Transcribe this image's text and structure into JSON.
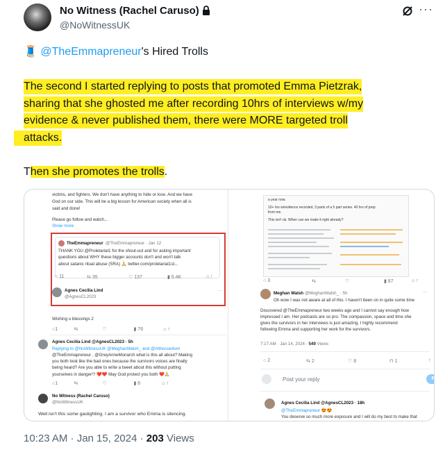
{
  "author": {
    "name": "No Witness (Rachel Caruso)",
    "handle": "@NoWitnessUK"
  },
  "icons": {
    "lock": "lock-icon",
    "grok": "grok-icon",
    "more": "more-icon",
    "spool": "spool-of-thread-emoji"
  },
  "body": {
    "line1_emoji": "🧵",
    "line1_mention": "@TheEmmapreneur",
    "line1_rest": "'s Hired Trolls",
    "p1": [
      "The second I started replying to posts that promoted Emma Pietzrak,",
      "sharing that she ghosted me after recording 10hrs of interviews w/my",
      "evidence & never published them, there were MORE targeted troll",
      "attacks."
    ],
    "p2_plain": "T",
    "p2_hl": "hen she promotes the trolls",
    "p2_end": "."
  },
  "media_left": {
    "top_text": [
      "victims, and fighters. We don't have anything to hide or lose. And we have",
      "God on our side. This will be a big lesson for American society when all is",
      "said and done!"
    ],
    "follow": "Please go follow and watch...",
    "show_more": "Show more",
    "quote_name": "TheEmmapreneur",
    "quote_handle": "@TheEmmapreneur · Jan 12",
    "quote_text": [
      "THANK YOU @Proletariat1 for the shout-out and for asking important",
      "questions about WHY these bigger accounts don't and won't talk",
      "about satanic ritual abuse (SRA) 🙏 twitter.com/proletariat1st..."
    ],
    "quote_actions": [
      "11",
      "35",
      "137",
      "5.4K"
    ],
    "reply1_name": "Agnes Cecilia Lind",
    "reply1_handle": "@AgnesCL2023",
    "wishing": "Wishing u blessings 2",
    "reply2_header": "Agnes Cecilia Lind @AgnesCL2023 · 5h",
    "reply2_text": [
      "Replying to @NoWitnessUK @MeghanWalsh_ and @Althouse4om",
      "@TheEmmapreneur , @GreyAnneMonarch what is this all about? Making",
      "you both look like the bad ones because the survivors voices are finally",
      "being heard? Are you able to write a tweet about this without putting",
      "yourselves in danger!? ❤️❤️ May God protect you both ❤️🙏"
    ],
    "reply3_name": "No Witness (Rachel Caruso)",
    "reply3_handle": "@NoWitnessUK",
    "reply3_text": "Well isn't this some gaslighting. I am a survivor who Emma is silencing."
  },
  "media_right": {
    "embed_lines": [
      "a year now.",
      "10+ hrs w/evidence recorded, 3 parts of a 5 part series. 40 hrs of prep",
      "from me.",
      "This isn't ok. When can we make it right already?"
    ],
    "embed_actions": [
      "3",
      "87"
    ],
    "meghan_name": "Meghan Walsh",
    "meghan_handle": "@MeghanWalsh_ · 5h",
    "meghan_line": "Oh wow I was not aware at all of this. I haven't been on in quite some time",
    "meghan_text": [
      "Discovered @TheEmmapreneur two weeks ago and I cannot say enough how",
      "impressed I am. Her podcasts are so pro. The compassion, space and time she",
      "gives the survivors in her interviews is just amazing. I highly recommend",
      "following Emma and supporting her work for the survivors."
    ],
    "meghan_time": "7:17 AM · Jan 14, 2024 · ",
    "meghan_views_num": "549",
    "meghan_views_label": " Views",
    "meghan_actions": [
      "2",
      "2",
      "8",
      "1"
    ],
    "post_reply": "Post your reply",
    "reply_btn": "Reply",
    "agnes_header": "Agnes Cecilia Lind @AgnesCL2023 · 18h",
    "agnes_handle_blue": "@TheEmmapreneur 😍😍",
    "agnes_text": "You deserve so much more exposure and I will do my best to make that"
  },
  "footer": {
    "time": "10:23 AM · Jan 15, 2024 · ",
    "views_num": "203",
    "views_label": " Views"
  }
}
